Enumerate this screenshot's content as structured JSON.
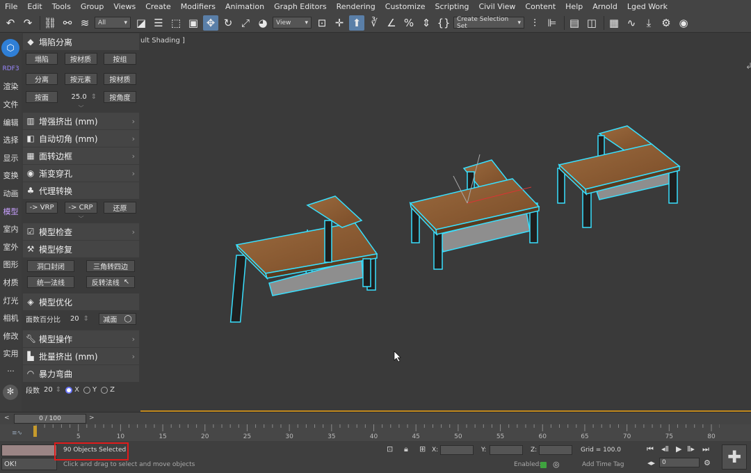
{
  "menubar": [
    "File",
    "Edit",
    "Tools",
    "Group",
    "Views",
    "Create",
    "Modifiers",
    "Animation",
    "Graph Editors",
    "Rendering",
    "Customize",
    "Scripting",
    "Civil View",
    "Content",
    "Help",
    "Arnold",
    "Lged Work"
  ],
  "toolbar": {
    "filter_value": "All",
    "view_value": "View",
    "selection_set_placeholder": "Create Selection Set"
  },
  "leftstrip": {
    "brand": "RDF3",
    "items": [
      "渲染",
      "文件",
      "编辑",
      "选择",
      "显示",
      "变换",
      "动画",
      "模型",
      "室内",
      "室外",
      "图形",
      "材质",
      "灯光",
      "相机",
      "修改",
      "实用"
    ],
    "more": "···"
  },
  "panel": {
    "collapse": {
      "title": "塌陷分离",
      "row1": [
        "塌陷",
        "按材质",
        "按组"
      ],
      "row2": [
        "分离",
        "按元素",
        "按材质"
      ],
      "row3_btn": "按面",
      "row3_value": "25.0",
      "row3_btn2": "按角度"
    },
    "extrude": "增强挤出 (mm)",
    "chamfer": "自动切角 (mm)",
    "face_border": "面转边框",
    "gradient_hole": "渐变穿孔",
    "proxy": {
      "title": "代理转换",
      "buttons": [
        "-> VRP",
        "-> CRP",
        "还原"
      ]
    },
    "model_check": "模型检查",
    "model_fix": {
      "title": "模型修复",
      "row1": [
        "洞口封闭",
        "三角转四边"
      ],
      "row2": [
        "统一法线",
        "反转法线"
      ]
    },
    "model_opt": {
      "title": "模型优化",
      "label": "面数百分比",
      "value": "20",
      "button": "减面"
    },
    "model_ops": "模型操作",
    "batch_extrude": "批量挤出 (mm)",
    "bend": {
      "title": "暴力弯曲",
      "label": "段数",
      "value": "20",
      "axes": [
        "X",
        "Y",
        "Z"
      ],
      "selected_axis": "X"
    }
  },
  "viewport": {
    "label": "ult Shading ]"
  },
  "timeslider": {
    "frame_text": "0 / 100",
    "prev": "<",
    "next": ">"
  },
  "track": {
    "ticks": [
      "5",
      "10",
      "15",
      "20",
      "25",
      "30",
      "35",
      "40",
      "45",
      "50",
      "55",
      "60",
      "65",
      "70",
      "75",
      "80"
    ]
  },
  "status": {
    "ok": "OK!",
    "selection": "90 Objects Selected",
    "hint": "Click and drag to select and move objects",
    "x_label": "X:",
    "y_label": "Y:",
    "z_label": "Z:",
    "grid": "Grid = 100.0",
    "enabled": "Enabled:",
    "add_time_tag": "Add Time Tag",
    "frame_value": "0"
  },
  "colors": {
    "selection_outline": "#e01b1b",
    "wire": "#38e0ff",
    "wood": "#8b5a32",
    "timeline_accent": "#c28a1e"
  }
}
